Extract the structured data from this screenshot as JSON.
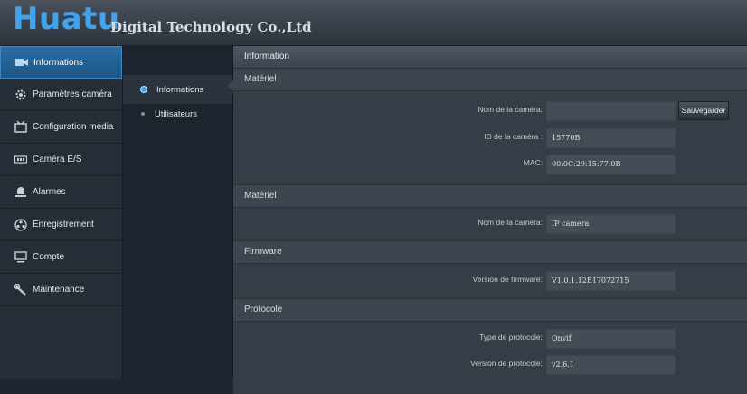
{
  "header": {
    "brand_big": "Huatu",
    "brand_small": "Digital Technology Co.,Ltd"
  },
  "nav": {
    "items": [
      {
        "label": "Informations",
        "icon": "camera-info-icon",
        "active": true
      },
      {
        "label": "Paramètres caméra",
        "icon": "gear-icon"
      },
      {
        "label": "Configuration média",
        "icon": "media-icon"
      },
      {
        "label": "Caméra E/S",
        "icon": "io-port-icon"
      },
      {
        "label": "Alarmes",
        "icon": "bell-icon"
      },
      {
        "label": "Enregistrement",
        "icon": "record-icon"
      },
      {
        "label": "Compte",
        "icon": "monitor-icon"
      },
      {
        "label": "Maintenance",
        "icon": "wrench-icon"
      }
    ]
  },
  "subnav": {
    "items": [
      {
        "label": "Informations",
        "active": true
      },
      {
        "label": "Utilisateurs"
      }
    ]
  },
  "main": {
    "title": "Information",
    "sections": [
      {
        "title": "Matériel",
        "fields": [
          {
            "label": "Nom de la caméra:",
            "value": ""
          },
          {
            "label": "ID de la caméra :",
            "value": "15770B"
          },
          {
            "label": "MAC:",
            "value": "00:0C:29:15:77:0B"
          }
        ],
        "save_label": "Sauvegarder"
      },
      {
        "title": "Matériel",
        "fields": [
          {
            "label": "Nom de la caméra:",
            "value": "IP camera"
          }
        ]
      },
      {
        "title": "Firmware",
        "fields": [
          {
            "label": "Version de firmware:",
            "value": "V1.0.1.12B17072715"
          }
        ]
      },
      {
        "title": "Protocole",
        "fields": [
          {
            "label": "Type de protocole:",
            "value": "Onvif"
          },
          {
            "label": "Version de protocole:",
            "value": "v2.6.1"
          }
        ]
      }
    ]
  },
  "colors": {
    "accent": "#3fa3ee",
    "active_nav": "#2a6ea6"
  }
}
